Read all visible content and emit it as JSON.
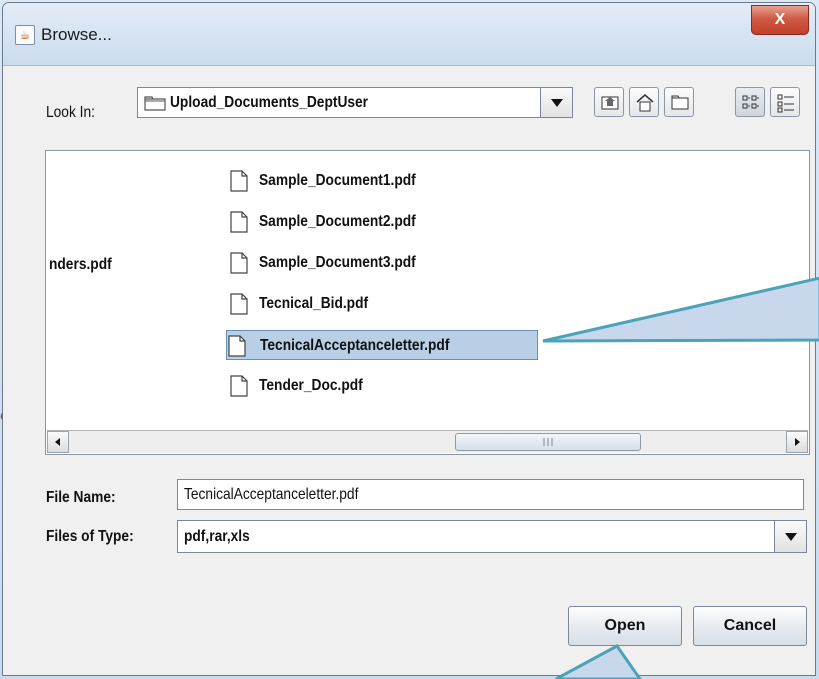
{
  "background": {
    "partial_text": "C"
  },
  "window": {
    "title": "Browse...",
    "close_label": "X"
  },
  "look_in": {
    "label": "Look In:",
    "value": "Upload_Documents_DeptUser"
  },
  "toolbar": {
    "up_icon": "up-folder-icon",
    "home_icon": "home-icon",
    "new_folder_icon": "new-folder-icon",
    "list_view_icon": "list-view-icon",
    "details_view_icon": "details-view-icon"
  },
  "file_list": {
    "left_column_partial": "nders.pdf",
    "files": [
      "Sample_Document1.pdf",
      "Sample_Document2.pdf",
      "Sample_Document3.pdf",
      "Tecnical_Bid.pdf",
      "TecnicalAcceptanceletter.pdf",
      "Tender_Doc.pdf"
    ],
    "selected_index": 4
  },
  "file_name": {
    "label": "File Name:",
    "value": "TecnicalAcceptanceletter.pdf"
  },
  "files_of_type": {
    "label": "Files of Type:",
    "value": "pdf,rar,xls"
  },
  "buttons": {
    "open": "Open",
    "cancel": "Cancel"
  },
  "colors": {
    "selection": "#b8cfe5",
    "close": "#c7442f",
    "callout": "#4aa3b8"
  }
}
